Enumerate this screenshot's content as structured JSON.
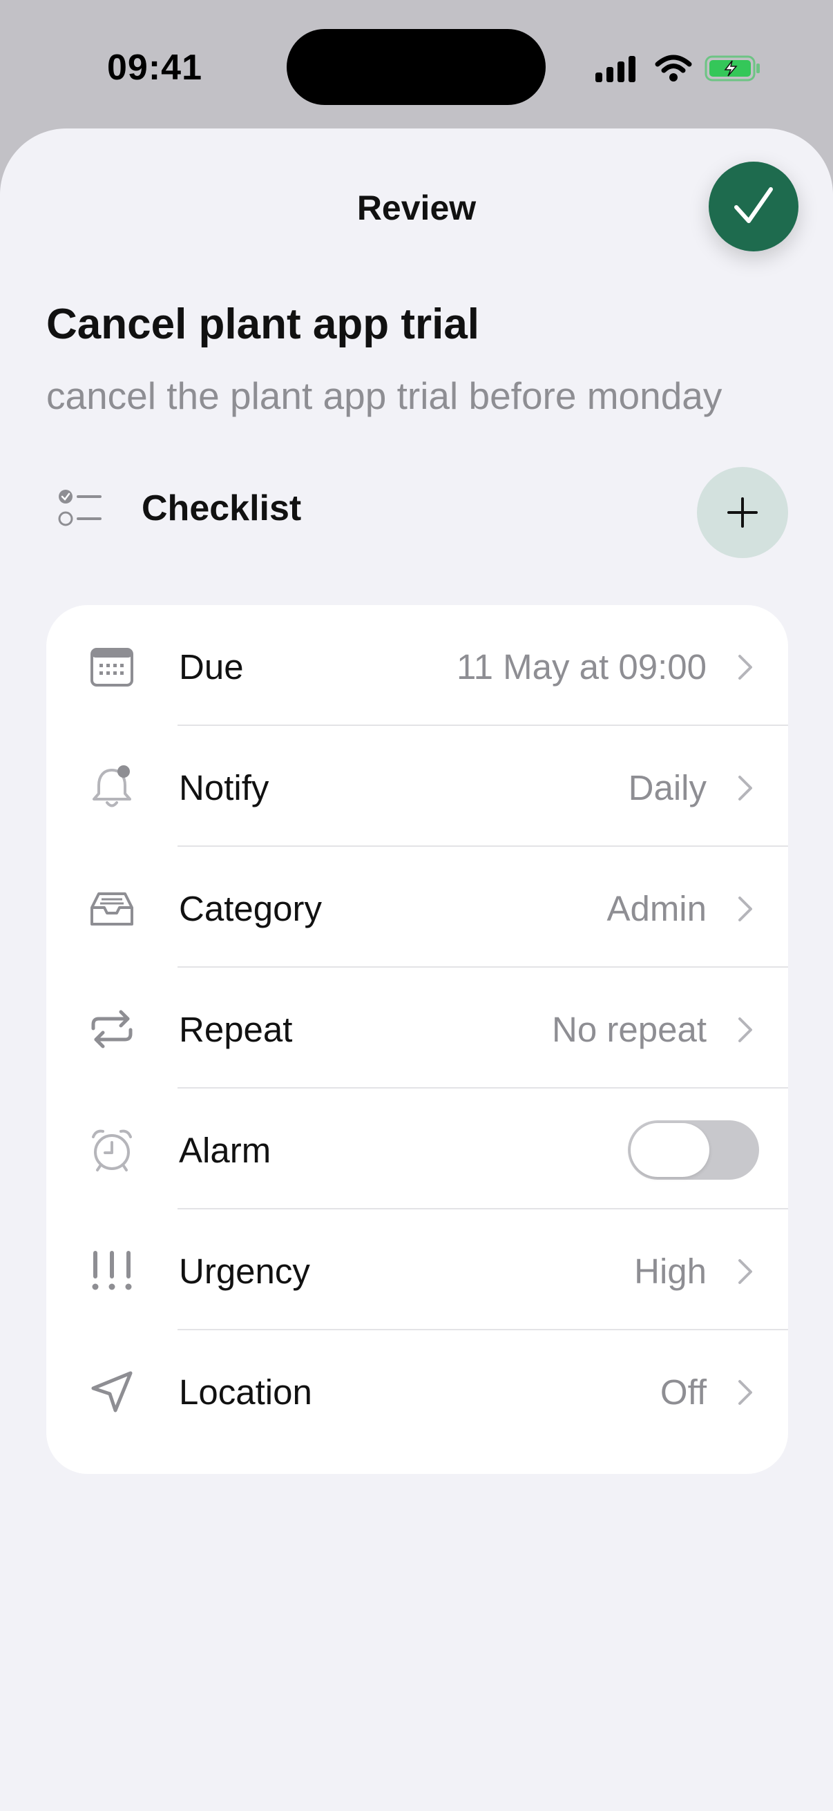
{
  "status_bar": {
    "time": "09:41"
  },
  "sheet": {
    "nav_title": "Review",
    "task_title": "Cancel plant app trial",
    "task_description": "cancel the plant app trial before monday",
    "checklist_label": "Checklist"
  },
  "settings": [
    {
      "icon": "calendar-icon",
      "label": "Due",
      "value": "11 May at 09:00"
    },
    {
      "icon": "bell-icon",
      "label": "Notify",
      "value": "Daily"
    },
    {
      "icon": "tray-icon",
      "label": "Category",
      "value": "Admin"
    },
    {
      "icon": "repeat-icon",
      "label": "Repeat",
      "value": "No repeat"
    },
    {
      "icon": "alarm-clock-icon",
      "label": "Alarm",
      "toggle_on": false
    },
    {
      "icon": "exclamation-icon",
      "label": "Urgency",
      "value": "High"
    },
    {
      "icon": "location-arrow-icon",
      "label": "Location",
      "value": "Off"
    }
  ],
  "colors": {
    "accent": "#1e6b4e",
    "add_button_bg": "#d3e1de",
    "sheet_bg": "#f2f2f7",
    "secondary_text": "#8e8e93",
    "battery_green": "#34c759"
  }
}
